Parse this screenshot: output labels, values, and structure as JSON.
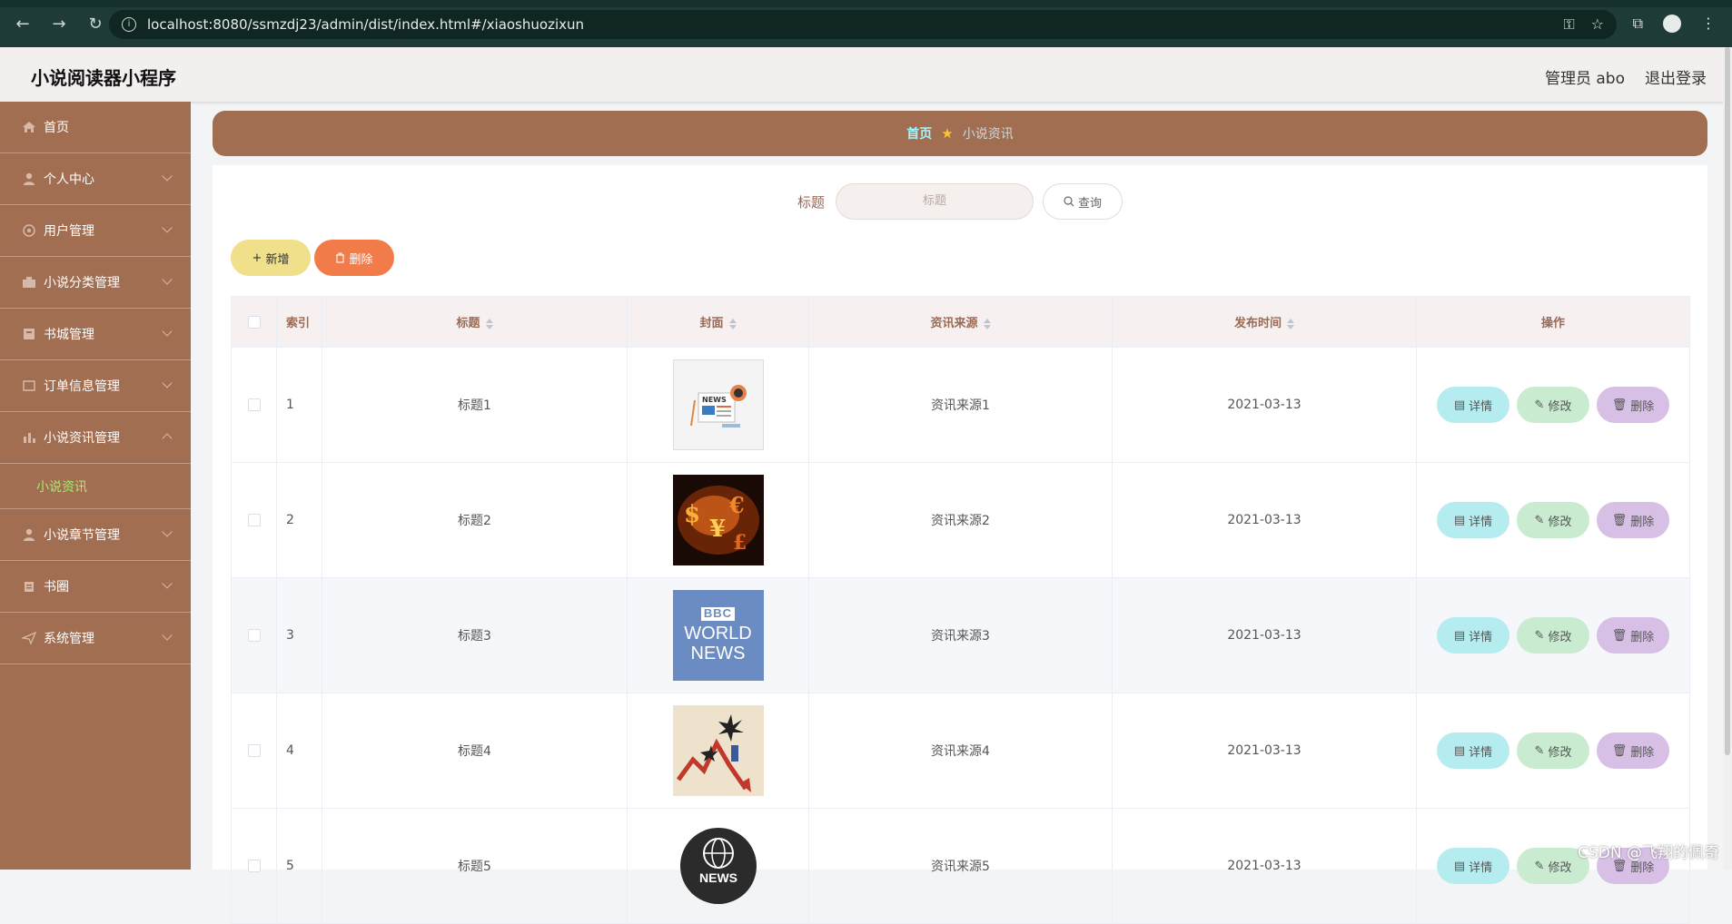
{
  "browser": {
    "url": "localhost:8080/ssmzdj23/admin/dist/index.html#/xiaoshuozixun"
  },
  "header": {
    "app_title": "小说阅读器小程序",
    "user_label": "管理员 abo",
    "logout_label": "退出登录"
  },
  "sidebar": {
    "items": [
      {
        "label": "首页",
        "icon": "home-icon"
      },
      {
        "label": "个人中心",
        "icon": "user-icon"
      },
      {
        "label": "用户管理",
        "icon": "users-icon"
      },
      {
        "label": "小说分类管理",
        "icon": "category-icon"
      },
      {
        "label": "书城管理",
        "icon": "book-icon"
      },
      {
        "label": "订单信息管理",
        "icon": "order-icon"
      },
      {
        "label": "小说资讯管理",
        "icon": "chart-icon"
      },
      {
        "label": "小说章节管理",
        "icon": "user-icon"
      },
      {
        "label": "书圈",
        "icon": "circle-icon"
      },
      {
        "label": "系统管理",
        "icon": "send-icon"
      }
    ],
    "sub_item": "小说资讯"
  },
  "breadcrumb": {
    "home": "首页",
    "current": "小说资讯"
  },
  "search": {
    "label": "标题",
    "placeholder": "标题",
    "button": "查询"
  },
  "toolbar": {
    "add_label": "新增",
    "delete_label": "删除"
  },
  "table": {
    "headers": {
      "index": "索引",
      "title": "标题",
      "cover": "封面",
      "source": "资讯来源",
      "date": "发布时间",
      "ops": "操作"
    },
    "rows": [
      {
        "index": "1",
        "title": "标题1",
        "source": "资讯来源1",
        "date": "2021-03-13"
      },
      {
        "index": "2",
        "title": "标题2",
        "source": "资讯来源2",
        "date": "2021-03-13"
      },
      {
        "index": "3",
        "title": "标题3",
        "source": "资讯来源3",
        "date": "2021-03-13"
      },
      {
        "index": "4",
        "title": "标题4",
        "source": "资讯来源4",
        "date": "2021-03-13"
      },
      {
        "index": "5",
        "title": "标题5",
        "source": "资讯来源5",
        "date": "2021-03-13"
      }
    ],
    "cover_texts": {
      "row1": "NEWS",
      "row3_a": "BBC",
      "row3_b": "WORLD",
      "row3_c": "NEWS",
      "row5": "NEWS"
    },
    "row_actions": {
      "detail": "详情",
      "edit": "修改",
      "delete": "删除"
    }
  },
  "watermark": "CSDN @飞翔的佩奇",
  "colors": {
    "sidebar": "#a26e52",
    "accent_green": "#9ff06b",
    "detail_btn": "#b5ecef",
    "edit_btn": "#c9ebd0",
    "delete_btn": "#d7bfe6"
  }
}
